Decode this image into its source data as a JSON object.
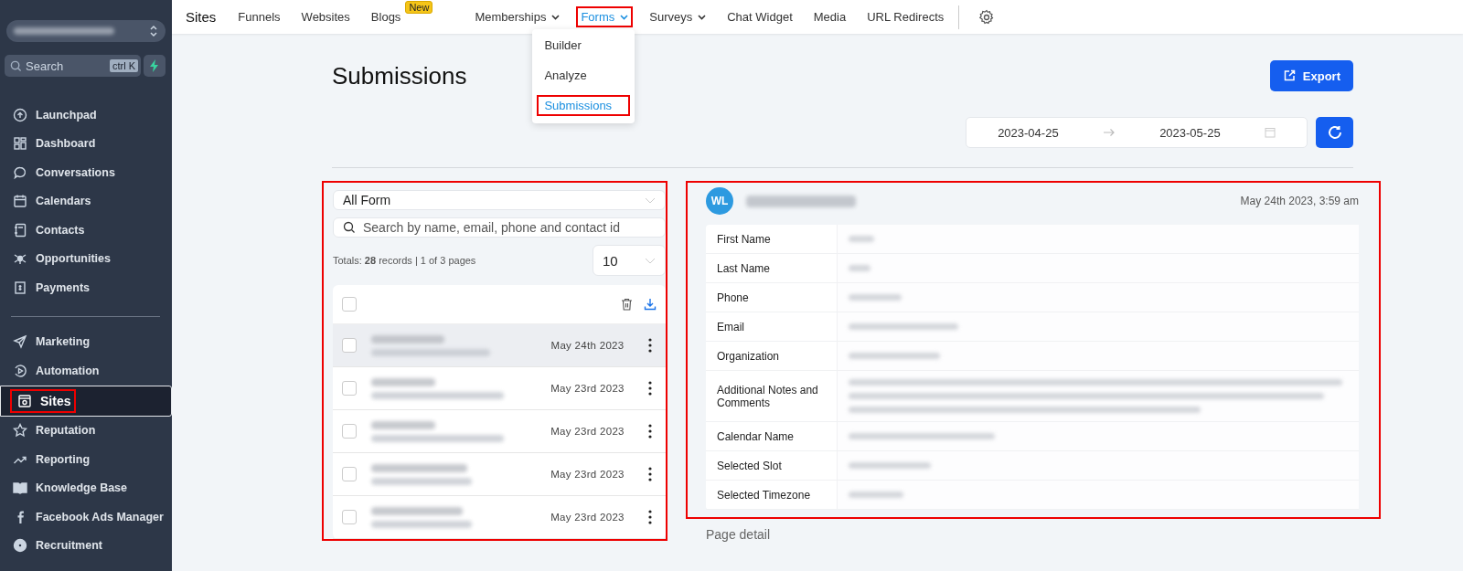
{
  "sidebar": {
    "search": {
      "placeholder": "Search",
      "shortcut": "ctrl K"
    },
    "sections": [
      [
        {
          "label": "Launchpad",
          "selected": false,
          "highlighted": false
        },
        {
          "label": "Dashboard",
          "selected": false,
          "highlighted": false
        },
        {
          "label": "Conversations",
          "selected": false,
          "highlighted": false
        },
        {
          "label": "Calendars",
          "selected": false,
          "highlighted": false
        },
        {
          "label": "Contacts",
          "selected": false,
          "highlighted": false
        },
        {
          "label": "Opportunities",
          "selected": false,
          "highlighted": false
        },
        {
          "label": "Payments",
          "selected": false,
          "highlighted": false
        }
      ],
      [
        {
          "label": "Marketing",
          "selected": false,
          "highlighted": false
        },
        {
          "label": "Automation",
          "selected": false,
          "highlighted": false
        },
        {
          "label": "Sites",
          "selected": true,
          "highlighted": true
        },
        {
          "label": "Reputation",
          "selected": false,
          "highlighted": false
        },
        {
          "label": "Reporting",
          "selected": false,
          "highlighted": false
        },
        {
          "label": "Knowledge Base",
          "selected": false,
          "highlighted": false
        },
        {
          "label": "Facebook Ads Manager",
          "selected": false,
          "highlighted": false
        },
        {
          "label": "Recruitment",
          "selected": false,
          "highlighted": false
        }
      ]
    ]
  },
  "topnav": {
    "title": "Sites",
    "tabs": [
      {
        "label": "Funnels",
        "selected": false,
        "highlighted": false,
        "dropdown": false
      },
      {
        "label": "Websites",
        "selected": false,
        "highlighted": false,
        "dropdown": false
      },
      {
        "label": "Blogs",
        "selected": false,
        "highlighted": false,
        "dropdown": false,
        "badge": "New"
      },
      {
        "label": "Memberships",
        "selected": false,
        "highlighted": false,
        "dropdown": true
      },
      {
        "label": "Forms",
        "selected": true,
        "highlighted": true,
        "dropdown": true
      },
      {
        "label": "Surveys",
        "selected": false,
        "highlighted": false,
        "dropdown": true
      },
      {
        "label": "Chat Widget",
        "selected": false,
        "highlighted": false,
        "dropdown": false
      },
      {
        "label": "Media",
        "selected": false,
        "highlighted": false,
        "dropdown": false
      },
      {
        "label": "URL Redirects",
        "selected": false,
        "highlighted": false,
        "dropdown": false
      }
    ],
    "menu": [
      {
        "label": "Builder",
        "selected": false,
        "highlighted": false
      },
      {
        "label": "Analyze",
        "selected": false,
        "highlighted": false
      },
      {
        "label": "Submissions",
        "selected": true,
        "highlighted": true
      }
    ]
  },
  "page": {
    "title": "Submissions",
    "export_button": "Export",
    "date_range": {
      "start": "2023-04-25",
      "end": "2023-05-25"
    }
  },
  "list_panel": {
    "highlighted": true,
    "form_filter": "All Form",
    "search_placeholder": "Search by name, email, phone and contact id",
    "totals": "Totals: **28** records | 1 of 3 pages",
    "page_size": "10",
    "select_all_checked": false,
    "rows": [
      {
        "date": "May 24th 2023",
        "selected": true,
        "checked": false
      },
      {
        "date": "May 23rd 2023",
        "selected": false,
        "checked": false
      },
      {
        "date": "May 23rd 2023",
        "selected": false,
        "checked": false
      },
      {
        "date": "May 23rd 2023",
        "selected": false,
        "checked": false
      },
      {
        "date": "May 23rd 2023",
        "selected": false,
        "checked": false
      }
    ]
  },
  "detail_panel": {
    "highlighted": true,
    "avatar": "WL",
    "timestamp": "May 24th 2023, 3:59 am",
    "fields": [
      {
        "label": "First Name",
        "kind": "short"
      },
      {
        "label": "Last Name",
        "kind": "short"
      },
      {
        "label": "Phone",
        "kind": "short"
      },
      {
        "label": "Email",
        "kind": "short"
      },
      {
        "label": "Organization",
        "kind": "short"
      },
      {
        "label": "Additional Notes and Comments",
        "kind": "long"
      },
      {
        "label": "Calendar Name",
        "kind": "short"
      },
      {
        "label": "Selected Slot",
        "kind": "short"
      },
      {
        "label": "Selected Timezone",
        "kind": "short"
      }
    ]
  },
  "footer": "Page detail"
}
